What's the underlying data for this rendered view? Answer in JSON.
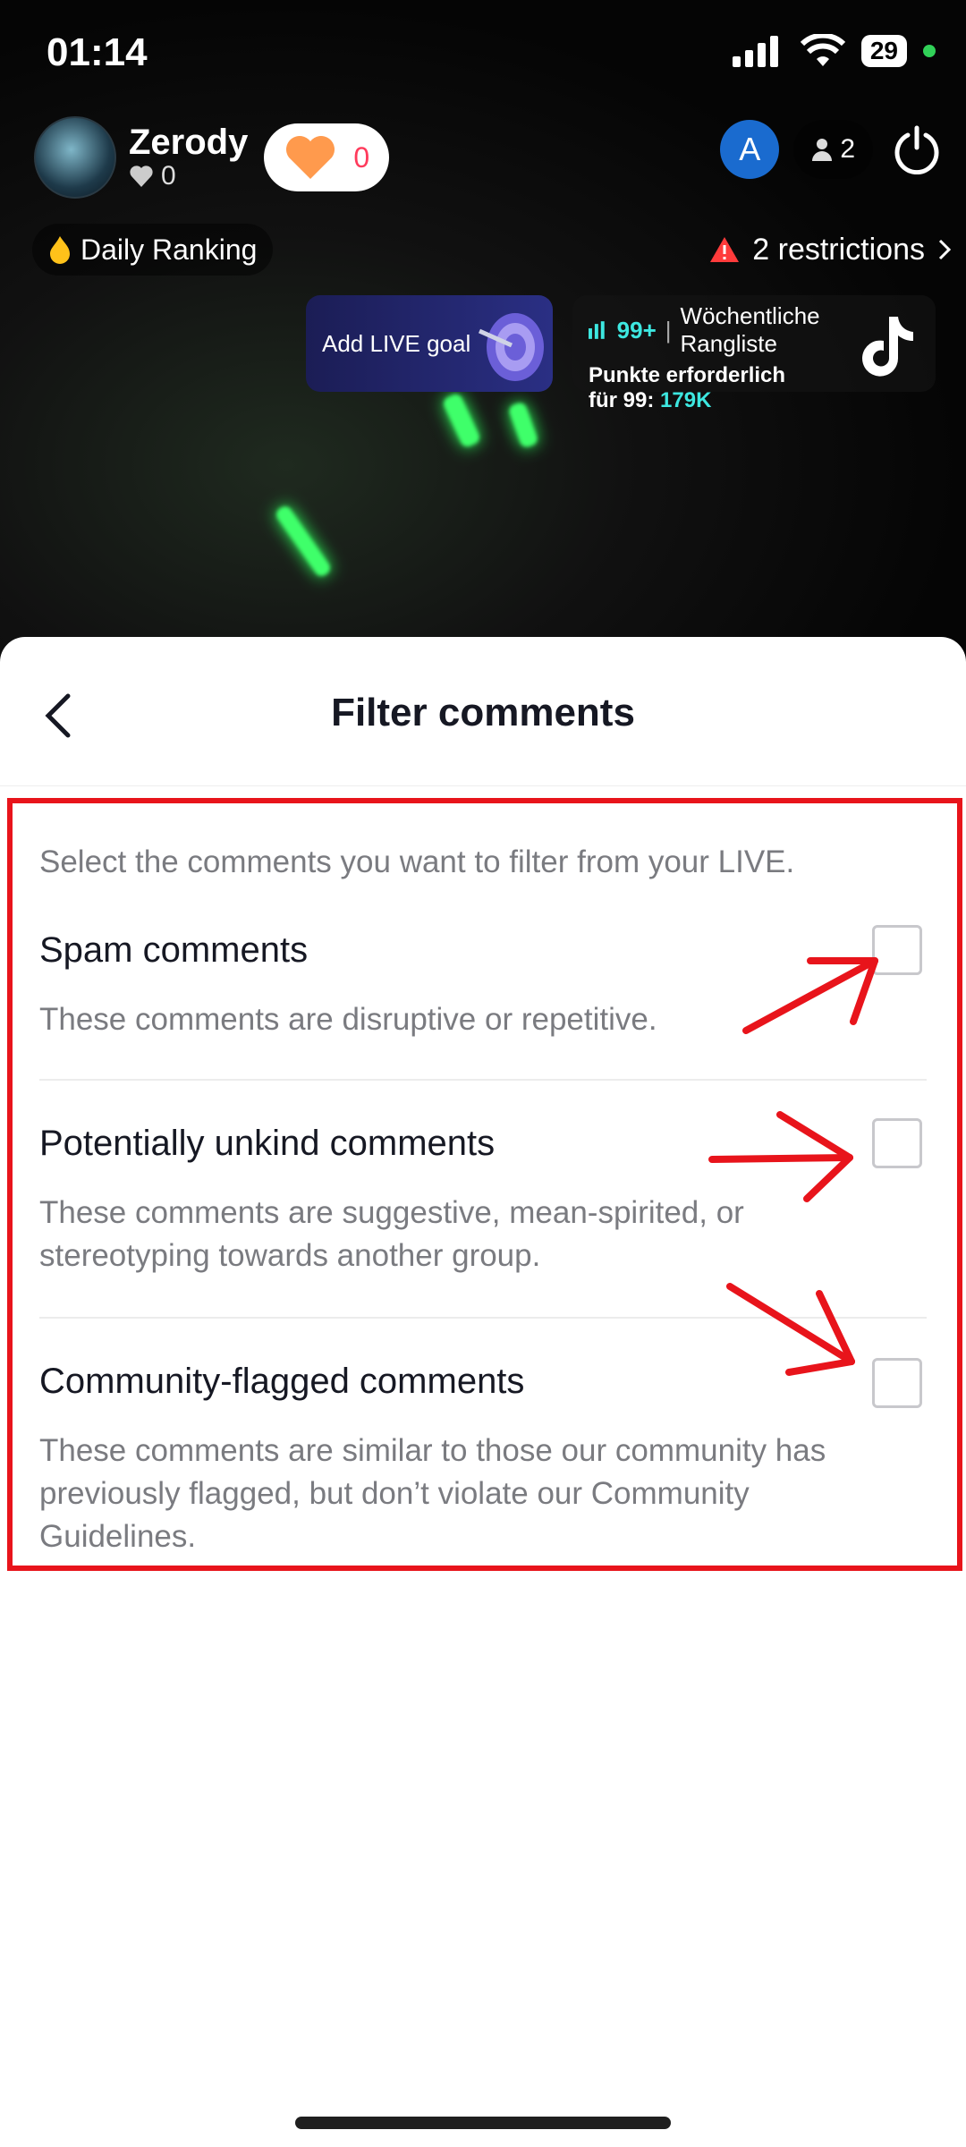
{
  "status_bar": {
    "time": "01:14",
    "battery": "29"
  },
  "host": {
    "name": "Zerody",
    "likes": "0",
    "gift_count": "0"
  },
  "top_right": {
    "badge_letter": "A",
    "viewers": "2"
  },
  "daily_ranking": {
    "label": "Daily Ranking"
  },
  "restrictions": {
    "label": "2 restrictions"
  },
  "live_goal": {
    "label": "Add LIVE goal"
  },
  "weekly": {
    "rank": "99+",
    "title": "Wöchentliche Rangliste",
    "points_line": "Punkte erforderlich",
    "points_for": "für 99:",
    "points_value": "179K"
  },
  "sheet": {
    "title": "Filter comments",
    "description": "Select the comments you want to filter from your LIVE.",
    "options": [
      {
        "title": "Spam comments",
        "description": "These comments are disruptive or repetitive.",
        "checked": false
      },
      {
        "title": "Potentially unkind comments",
        "description": "These comments are suggestive, mean-spirited, or stereotyping towards another group.",
        "checked": false
      },
      {
        "title": "Community-flagged comments",
        "description": "These comments are similar to those our community has previously flagged, but don’t violate our Community Guidelines.",
        "checked": false
      }
    ]
  },
  "colors": {
    "annotation_red": "#e8141b",
    "accent_cyan": "#3de7e0",
    "gift_red": "#ff3b5c"
  }
}
